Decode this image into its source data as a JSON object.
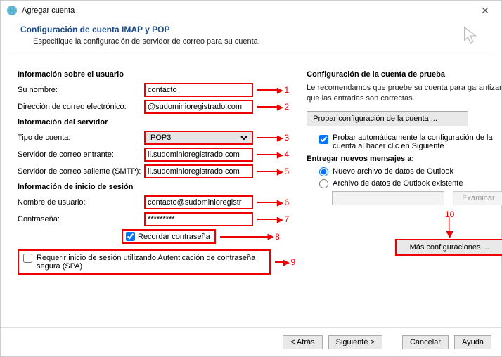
{
  "window": {
    "title": "Agregar cuenta"
  },
  "header": {
    "title": "Configuración de cuenta IMAP y POP",
    "subtitle": "Especifique la configuración de servidor de correo para su cuenta."
  },
  "left": {
    "section_user": "Información sobre el usuario",
    "name_label": "Su nombre:",
    "name_value": "contacto",
    "email_label": "Dirección de correo electrónico:",
    "email_value": "@sudominioregistrado.com",
    "section_server": "Información del servidor",
    "account_type_label": "Tipo de cuenta:",
    "account_type_value": "POP3",
    "incoming_label": "Servidor de correo entrante:",
    "incoming_value": "il.sudominioregistrado.com",
    "outgoing_label": "Servidor de correo saliente (SMTP):",
    "outgoing_value": "il.sudominioregistrado.com",
    "section_login": "Información de inicio de sesión",
    "username_label": "Nombre de usuario:",
    "username_value": "contacto@sudominioregistr",
    "password_label": "Contraseña:",
    "password_value": "*********",
    "remember_label": "Recordar contraseña",
    "spa_label": "Requerir inicio de sesión utilizando Autenticación de contraseña segura (SPA)"
  },
  "right": {
    "section_test": "Configuración de la cuenta de prueba",
    "note": "Le recomendamos que pruebe su cuenta para garantizar que las entradas son correctas.",
    "test_btn": "Probar configuración de la cuenta ...",
    "auto_test_label": "Probar automáticamente la configuración de la cuenta al hacer clic en Siguiente",
    "deliver_section": "Entregar nuevos mensajes a:",
    "radio_new": "Nuevo archivo de datos de Outlook",
    "radio_existing": "Archivo de datos de Outlook existente",
    "browse_btn": "Examinar",
    "more_btn": "Más configuraciones ..."
  },
  "annot": {
    "n1": "1",
    "n2": "2",
    "n3": "3",
    "n4": "4",
    "n5": "5",
    "n6": "6",
    "n7": "7",
    "n8": "8",
    "n9": "9",
    "n10": "10"
  },
  "footer": {
    "back": "< Atrás",
    "next": "Siguiente >",
    "cancel": "Cancelar",
    "help": "Ayuda"
  }
}
